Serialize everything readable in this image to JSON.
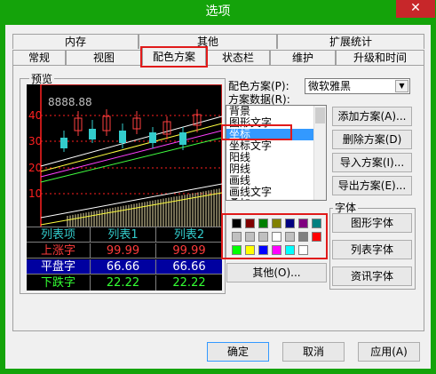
{
  "window": {
    "title": "选项",
    "close_glyph": "✕"
  },
  "tabs": {
    "row1": [
      "内存",
      "其他",
      "扩展统计"
    ],
    "row2": [
      "常规",
      "视图",
      "配色方案",
      "状态栏",
      "维护",
      "升级和时间"
    ],
    "active": "配色方案"
  },
  "preview": {
    "label": "预览",
    "price_label": "8888.88",
    "axis": [
      "40",
      "30",
      "20",
      "10"
    ],
    "table": {
      "header": [
        "列表项",
        "列表1",
        "列表2"
      ],
      "rows": [
        [
          "上涨字",
          "99.99",
          "99.99"
        ],
        [
          "平盘字",
          "66.66",
          "66.66"
        ],
        [
          "下跌字",
          "22.22",
          "22.22"
        ]
      ]
    }
  },
  "scheme": {
    "label": "配色方案(P):",
    "value": "微软雅黑",
    "data_label": "方案数据(R):",
    "items": [
      "背景",
      "图形文字",
      "坐标",
      "坐标文字",
      "阳线",
      "阴线",
      "画线",
      "画线文字",
      "叠加"
    ],
    "selected": "坐标"
  },
  "buttons": {
    "add": "添加方案(A)...",
    "delete": "删除方案(D)",
    "import": "导入方案(I)...",
    "export": "导出方案(E)...",
    "other": "其他(O)...",
    "ok": "确定",
    "cancel": "取消",
    "apply": "应用(A)"
  },
  "font": {
    "label": "字体",
    "graphic": "图形字体",
    "list": "列表字体",
    "info": "资讯字体"
  },
  "palette": [
    "#000000",
    "#800000",
    "#008000",
    "#808000",
    "#000080",
    "#800080",
    "#008080",
    "#c0c0c0",
    "#c0c0c0",
    "#c0c0c0",
    "#ffffff",
    "#c0c0c0",
    "#808080",
    "#ff0000",
    "#00ff00",
    "#ffff00",
    "#0000ff",
    "#ff00ff",
    "#00ffff",
    "#ffffff"
  ],
  "colors": {
    "titlebar": "#14a30a",
    "highlight": "#3399ff",
    "annotation": "#e01a1a",
    "rise": "#ff3b3b",
    "flat": "#ffffff",
    "fall": "#33ff33",
    "header": "#33cccc"
  }
}
